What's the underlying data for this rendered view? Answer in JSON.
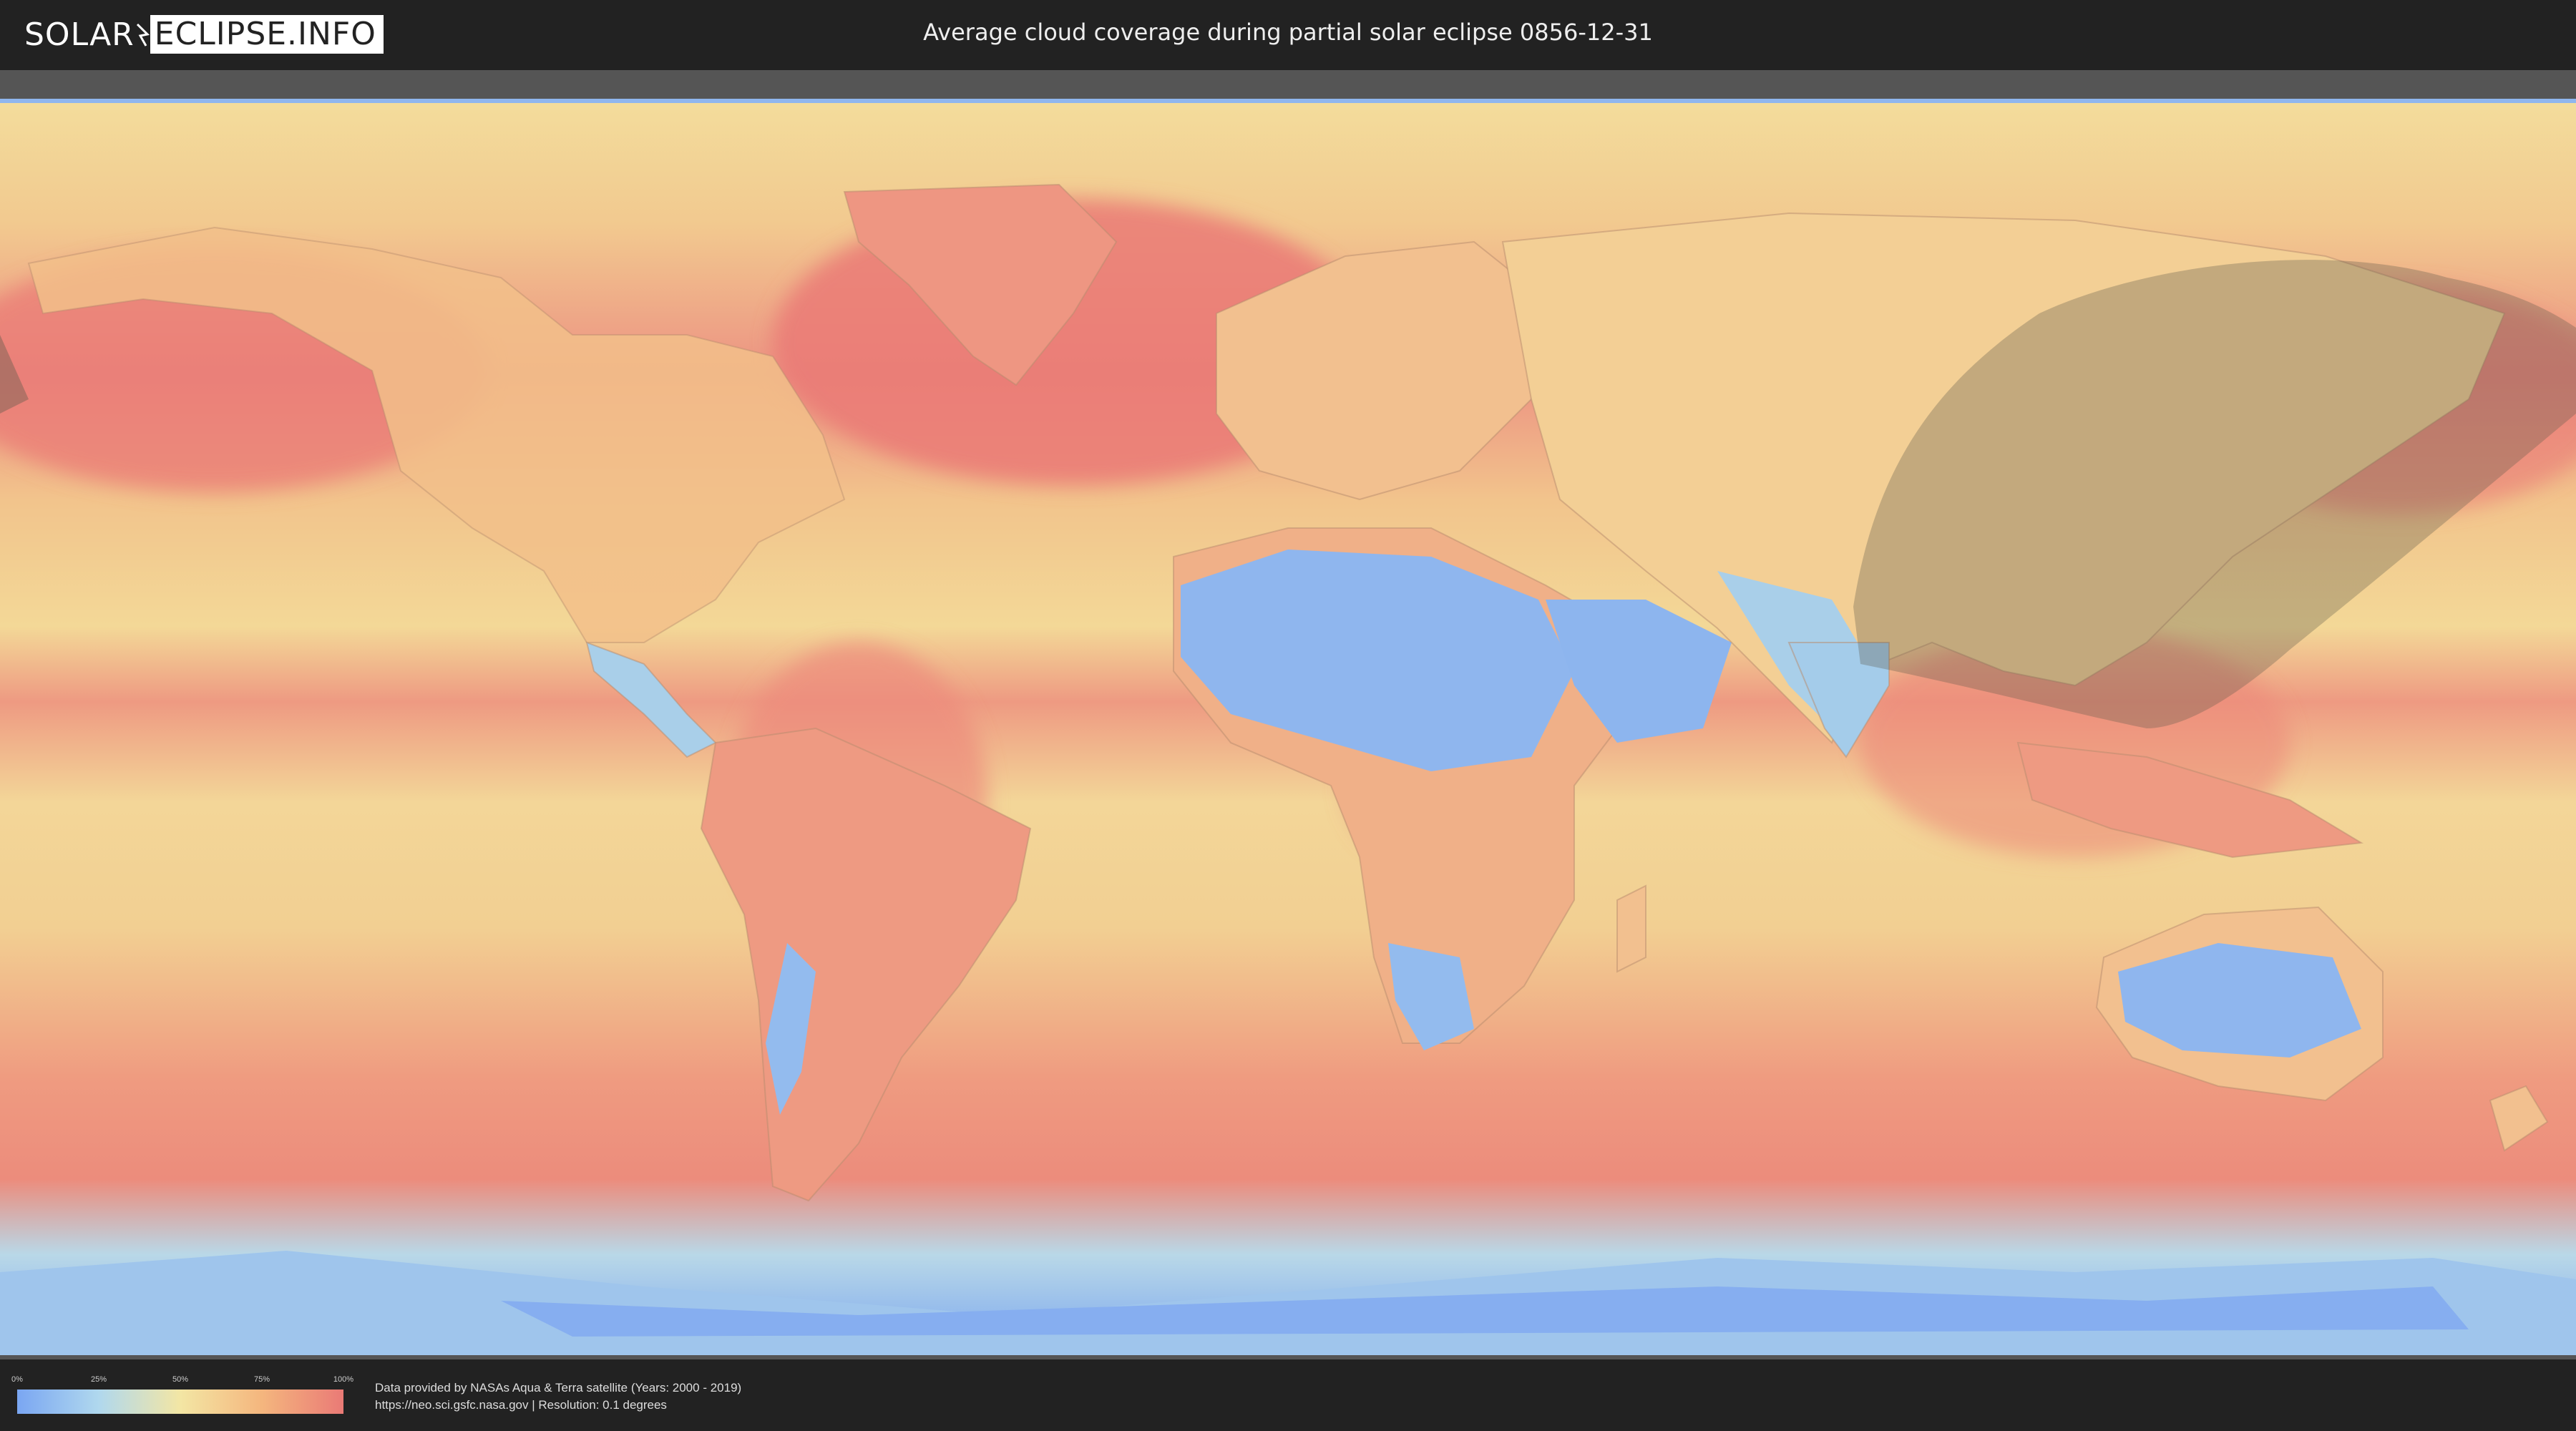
{
  "header": {
    "logo_left": "SOLAR",
    "logo_right": "ECLIPSE.INFO",
    "title": "Average cloud coverage during partial solar eclipse 0856-12-31"
  },
  "legend": {
    "ticks": [
      "0%",
      "25%",
      "50%",
      "75%",
      "100%"
    ],
    "colors": [
      "#7aa6f2",
      "#b0d8ee",
      "#f3e6a4",
      "#f4b67e",
      "#ea7a76"
    ]
  },
  "credits": {
    "line1": "Data provided by NASAs Aqua & Terra satellite (Years: 2000 - 2019)",
    "line2": "https://neo.sci.gsfc.nasa.gov | Resolution: 0.1 degrees"
  },
  "map": {
    "projection": "equirectangular",
    "colors": {
      "clear": "#7aa6f2",
      "cloudy": "#ea7a76",
      "mid": "#f3e6a4",
      "eclipse_shadow": "#6b6b5c"
    }
  }
}
